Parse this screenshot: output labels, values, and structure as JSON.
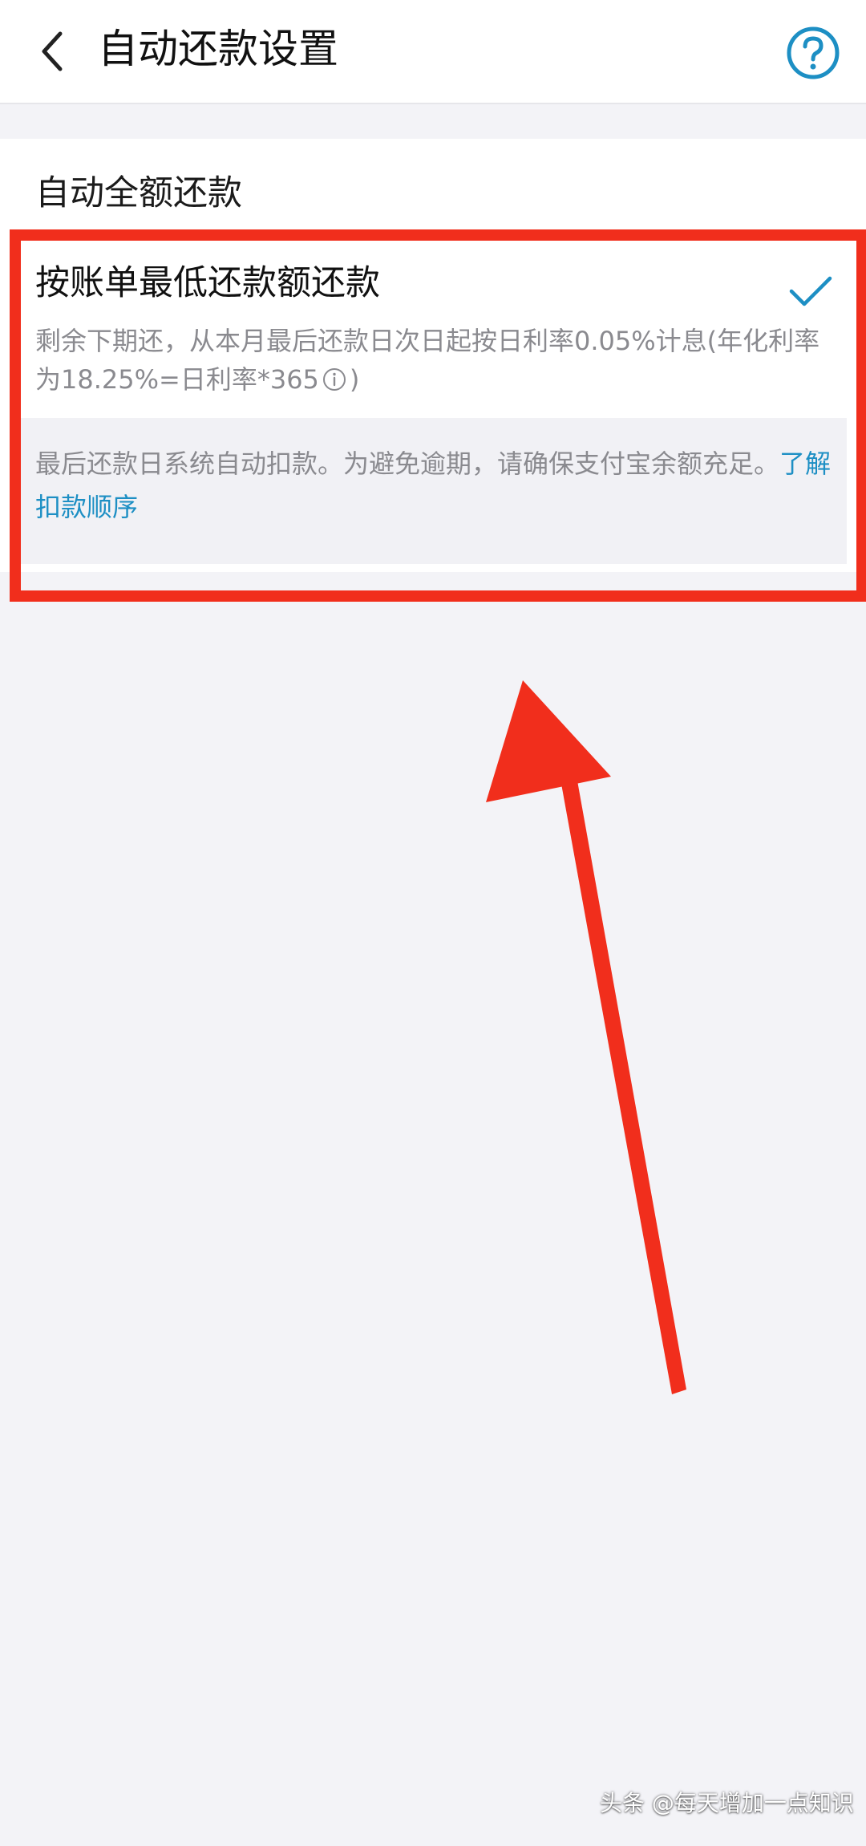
{
  "header": {
    "title": "自动还款设置",
    "back_icon": "chevron-left-icon",
    "help_icon": "question-circle-icon"
  },
  "options": {
    "full": {
      "label": "自动全额还款"
    },
    "minimum": {
      "label": "按账单最低还款额还款",
      "selected": true,
      "description": "剩余下期还，从本月最后还款日次日起按日利率0.05%计息(年化利率为18.25%=日利率*365",
      "description_tail": ")"
    }
  },
  "notice": {
    "text": "最后还款日系统自动扣款。为避免逾期，请确保支付宝余额充足。",
    "link": "了解扣款顺序"
  },
  "watermark": {
    "text": "头条 @每天增加一点知识"
  },
  "colors": {
    "accent": "#1d8fc4",
    "annotation_red": "#f12e1c",
    "background": "#f3f3f7"
  }
}
